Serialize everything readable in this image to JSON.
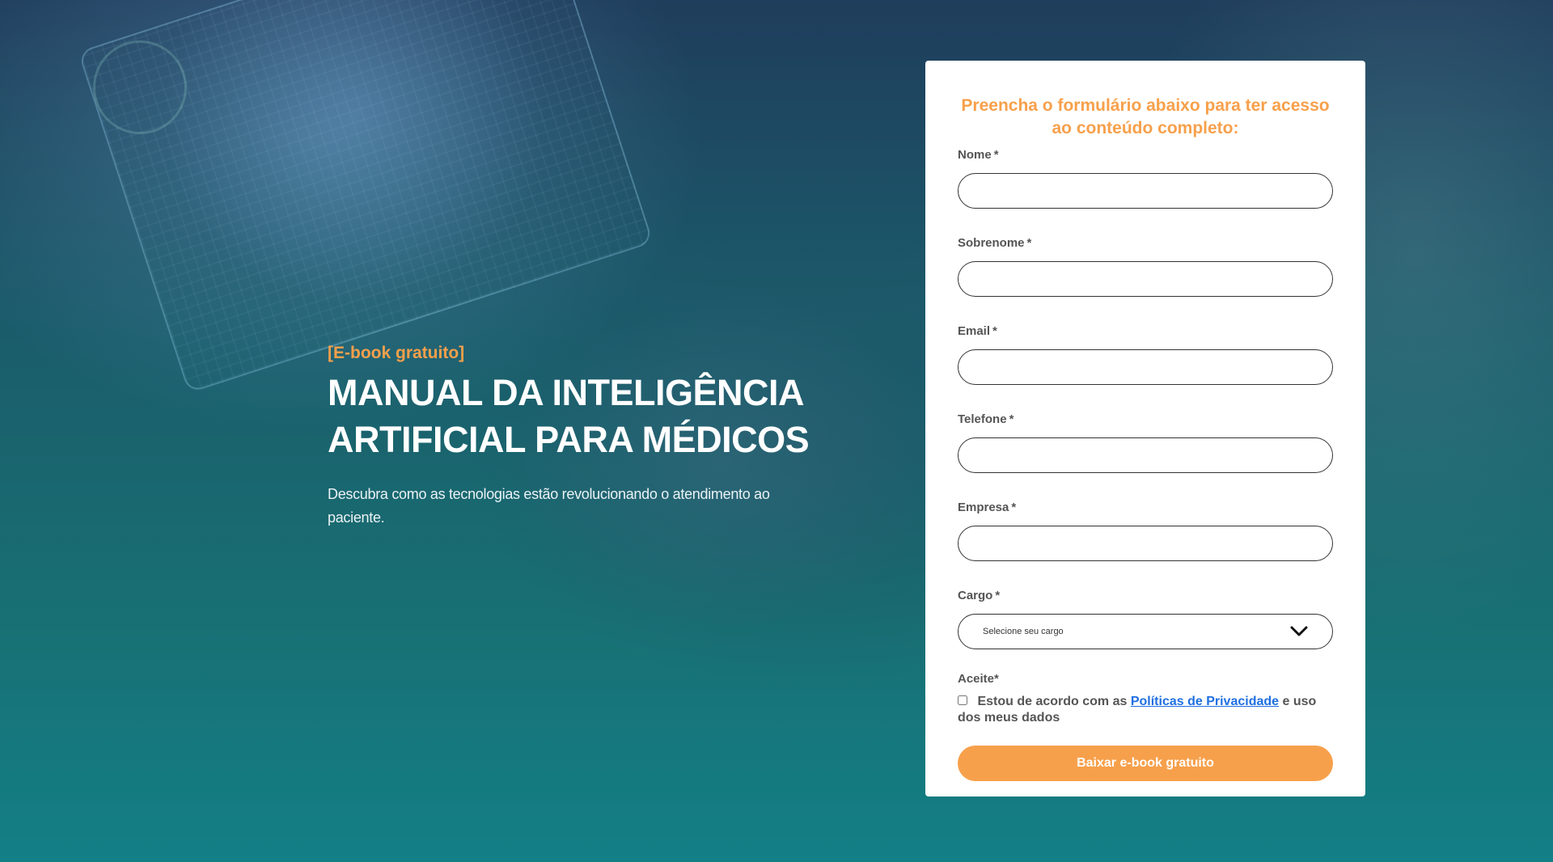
{
  "hero": {
    "tag": "[E-book gratuito]",
    "title_line1": "MANUAL DA INTELIGÊNCIA",
    "title_line2": "ARTIFICIAL PARA MÉDICOS",
    "description": "Descubra como as tecnologias estão revolucionando o atendimento ao paciente."
  },
  "form": {
    "heading": "Preencha o formulário abaixo para ter acesso ao conteúdo completo:",
    "required_marker": "*",
    "fields": {
      "nome": {
        "label": "Nome",
        "value": ""
      },
      "sobrenome": {
        "label": "Sobrenome",
        "value": ""
      },
      "email": {
        "label": "Email",
        "value": ""
      },
      "telefone": {
        "label": "Telefone",
        "value": ""
      },
      "empresa": {
        "label": "Empresa",
        "value": ""
      },
      "cargo": {
        "label": "Cargo",
        "selected": "Selecione seu cargo"
      }
    },
    "consent": {
      "label": "Aceite",
      "text_before": "Estou de acordo com as",
      "link_text": "Políticas de Privacidade",
      "text_after": "e uso dos meus dados",
      "checked": false
    },
    "submit_label": "Baixar e-book gratuito"
  },
  "colors": {
    "accent": "#f7a04b",
    "link": "#1f6fe0",
    "background_top": "#1f3d5c",
    "background_bottom": "#137f86"
  },
  "icons": {
    "select_arrow": "chevron-down-icon"
  }
}
